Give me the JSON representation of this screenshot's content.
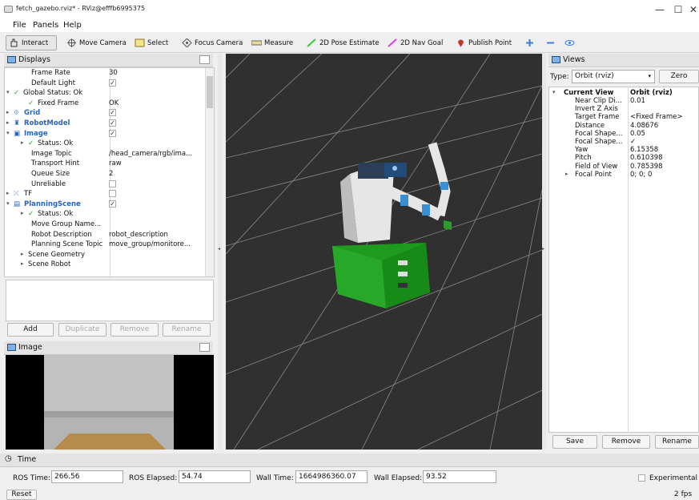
{
  "window": {
    "title": "fetch_gazebo.rviz* - RViz@efffb6995375",
    "min": "—",
    "max": "☐",
    "close": "✕"
  },
  "menu": [
    "File",
    "Panels",
    "Help"
  ],
  "toolbar": {
    "interact": "Interact",
    "move_camera": "Move Camera",
    "select": "Select",
    "focus_camera": "Focus Camera",
    "measure": "Measure",
    "pose_estimate": "2D Pose Estimate",
    "nav_goal": "2D Nav Goal",
    "publish_point": "Publish Point",
    "colors": {
      "pose_estimate": "#3cc83c",
      "nav_goal": "#e040e0",
      "publish_point": "#c0392b",
      "plus": "#3b7fd9"
    }
  },
  "displays": {
    "title": "Displays",
    "rows": [
      {
        "label": "Frame Rate",
        "value": "30",
        "indent": 1
      },
      {
        "label": "Default Light",
        "check": "✓",
        "indent": 1
      },
      {
        "label": "Global Status: Ok",
        "indent": 0,
        "tri": "▾",
        "status": "✓"
      },
      {
        "label": "Fixed Frame",
        "value": "OK",
        "indent": 1,
        "status": "✓"
      },
      {
        "label": "Grid",
        "indent": 0,
        "tri": "▸",
        "blue": true,
        "check": "✓",
        "icon": "grid-icon"
      },
      {
        "label": "RobotModel",
        "indent": 0,
        "tri": "▸",
        "blue": true,
        "check": "✓",
        "icon": "robot-icon"
      },
      {
        "label": "Image",
        "indent": 0,
        "tri": "▾",
        "blue": true,
        "check": "✓",
        "icon": "image-icon"
      },
      {
        "label": "Status: Ok",
        "indent": 1,
        "tri": "▸",
        "status": "✓"
      },
      {
        "label": "Image Topic",
        "value": "/head_camera/rgb/ima...",
        "indent": 1
      },
      {
        "label": "Transport Hint",
        "value": "raw",
        "indent": 1
      },
      {
        "label": "Queue Size",
        "value": "2",
        "indent": 1
      },
      {
        "label": "Unreliable",
        "check": " ",
        "indent": 1
      },
      {
        "label": "TF",
        "indent": 0,
        "tri": "▸",
        "check": " ",
        "icon": "tf-icon"
      },
      {
        "label": "PlanningScene",
        "indent": 0,
        "tri": "▾",
        "blue": true,
        "check": "✓",
        "icon": "planning-icon"
      },
      {
        "label": "Status: Ok",
        "indent": 1,
        "tri": "▸",
        "status": "✓"
      },
      {
        "label": "Move Group Name...",
        "indent": 1
      },
      {
        "label": "Robot Description",
        "value": "robot_description",
        "indent": 1
      },
      {
        "label": "Planning Scene Topic",
        "value": "move_group/monitore...",
        "indent": 1
      },
      {
        "label": "Scene Geometry",
        "indent": 1,
        "tri": "▸"
      },
      {
        "label": "Scene Robot",
        "indent": 1,
        "tri": "▸"
      }
    ],
    "buttons": {
      "add": "Add",
      "duplicate": "Duplicate",
      "remove": "Remove",
      "rename": "Rename"
    }
  },
  "image_panel": {
    "title": "Image"
  },
  "views": {
    "title": "Views",
    "type_label": "Type:",
    "type_value": "Orbit (rviz)",
    "zero": "Zero",
    "current_view": "Current View",
    "current_view_value": "Orbit (rviz)",
    "props": [
      {
        "label": "Near Clip Di...",
        "value": "0.01"
      },
      {
        "label": "Invert Z Axis",
        "value": " "
      },
      {
        "label": "Target Frame",
        "value": "<Fixed Frame>"
      },
      {
        "label": "Distance",
        "value": "4.08676"
      },
      {
        "label": "Focal Shape...",
        "value": "0.05"
      },
      {
        "label": "Focal Shape...",
        "value": "✓"
      },
      {
        "label": "Yaw",
        "value": "6.15358"
      },
      {
        "label": "Pitch",
        "value": "0.610398"
      },
      {
        "label": "Field of View",
        "value": "0.785398"
      },
      {
        "label": "Focal Point",
        "value": "0; 0; 0"
      }
    ],
    "save": "Save",
    "remove": "Remove",
    "rename": "Rename"
  },
  "time": {
    "title": "Time",
    "ros_time_label": "ROS Time:",
    "ros_time": "266.56",
    "ros_elapsed_label": "ROS Elapsed:",
    "ros_elapsed": "54.74",
    "wall_time_label": "Wall Time:",
    "wall_time": "1664986360.07",
    "wall_elapsed_label": "Wall Elapsed:",
    "wall_elapsed": "93.52",
    "experimental": "Experimental",
    "reset": "Reset",
    "fps": "2 fps"
  }
}
